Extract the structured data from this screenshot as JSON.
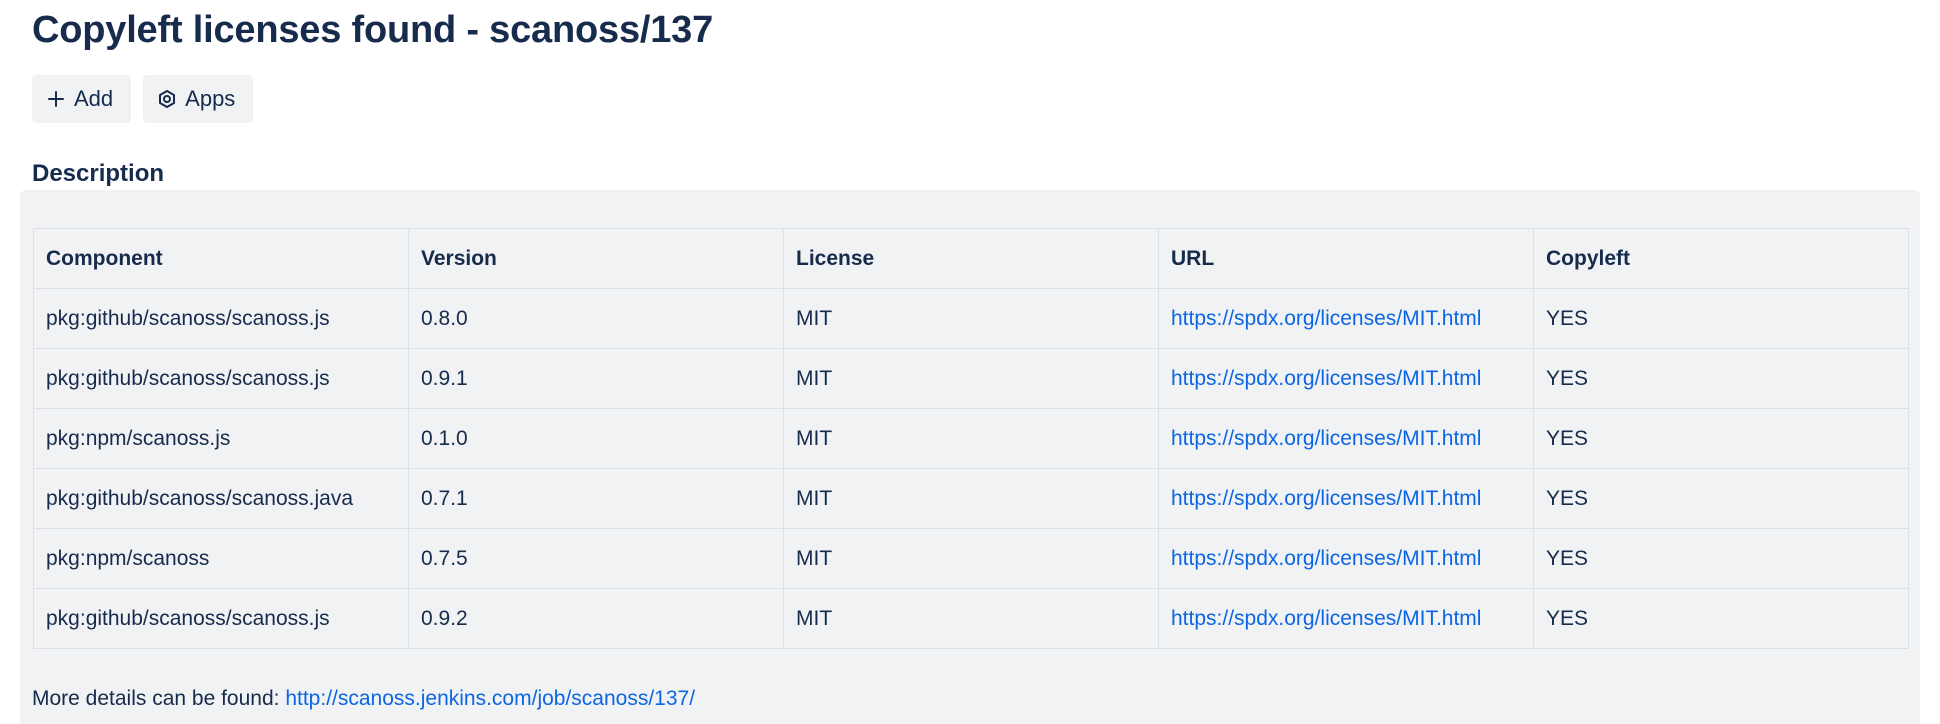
{
  "page": {
    "title": "Copyleft licenses found - scanoss/137"
  },
  "toolbar": {
    "add_label": "Add",
    "add_icon": "plus-icon",
    "apps_label": "Apps",
    "apps_icon": "hexagon-gear-icon"
  },
  "description": {
    "heading": "Description"
  },
  "table": {
    "headers": [
      "Component",
      "Version",
      "License",
      "URL",
      "Copyleft"
    ],
    "rows": [
      {
        "component": "pkg:github/scanoss/scanoss.js",
        "version": "0.8.0",
        "license": "MIT",
        "url": "https://spdx.org/licenses/MIT.html",
        "copyleft": "YES"
      },
      {
        "component": "pkg:github/scanoss/scanoss.js",
        "version": "0.9.1",
        "license": "MIT",
        "url": "https://spdx.org/licenses/MIT.html",
        "copyleft": "YES"
      },
      {
        "component": "pkg:npm/scanoss.js",
        "version": "0.1.0",
        "license": "MIT",
        "url": "https://spdx.org/licenses/MIT.html",
        "copyleft": "YES"
      },
      {
        "component": "pkg:github/scanoss/scanoss.java",
        "version": "0.7.1",
        "license": "MIT",
        "url": "https://spdx.org/licenses/MIT.html",
        "copyleft": "YES"
      },
      {
        "component": "pkg:npm/scanoss",
        "version": "0.7.5",
        "license": "MIT",
        "url": "https://spdx.org/licenses/MIT.html",
        "copyleft": "YES"
      },
      {
        "component": "pkg:github/scanoss/scanoss.js",
        "version": "0.9.2",
        "license": "MIT",
        "url": "https://spdx.org/licenses/MIT.html",
        "copyleft": "YES"
      }
    ]
  },
  "footer": {
    "prefix": "More details can be found: ",
    "link_text": "http://scanoss.jenkins.com/job/scanoss/137/"
  },
  "colors": {
    "text": "#172b4d",
    "link": "#0c66e4",
    "panel_bg": "#f1f2f4",
    "border": "#dcdfe4"
  }
}
